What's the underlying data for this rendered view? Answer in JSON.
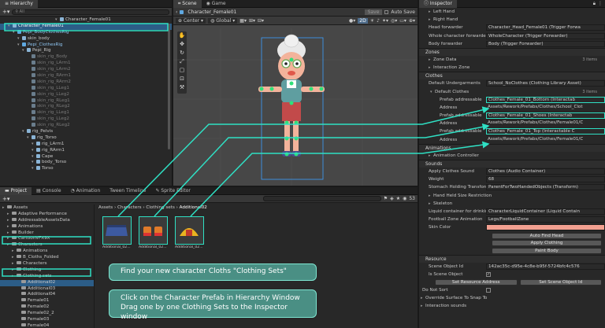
{
  "hierarchy": {
    "tab": "Hierarchy",
    "search_placeholder": "All",
    "items": [
      {
        "label": "Character_Female01",
        "indent": 0,
        "style": "root"
      },
      {
        "label": "Character_Female01",
        "indent": 1,
        "style": "selected"
      },
      {
        "label": "Pepi_BodyClothesRig",
        "indent": 2,
        "style": "blue"
      },
      {
        "label": "skin_body",
        "indent": 3,
        "style": "normal"
      },
      {
        "label": "Pepi_ClothesRig",
        "indent": 3,
        "style": "blue"
      },
      {
        "label": "Pepi_Rig",
        "indent": 4,
        "style": "normal"
      },
      {
        "label": "skin_rig_Body",
        "indent": 5,
        "style": "dim"
      },
      {
        "label": "skin_rig_LArm1",
        "indent": 5,
        "style": "dim"
      },
      {
        "label": "skin_rig_LArm2",
        "indent": 5,
        "style": "dim"
      },
      {
        "label": "skin_rig_RArm1",
        "indent": 5,
        "style": "dim"
      },
      {
        "label": "skin_rig_RArm2",
        "indent": 5,
        "style": "dim"
      },
      {
        "label": "skin_rig_LLeg1",
        "indent": 5,
        "style": "dim"
      },
      {
        "label": "skin_rig_LLeg2",
        "indent": 5,
        "style": "dim"
      },
      {
        "label": "skin_rig_RLeg1",
        "indent": 5,
        "style": "dim"
      },
      {
        "label": "skin_rig_RLeg2",
        "indent": 5,
        "style": "dim"
      },
      {
        "label": "skin_rig_LLeg1",
        "indent": 5,
        "style": "dim"
      },
      {
        "label": "skin_rig_LLeg2",
        "indent": 5,
        "style": "dim"
      },
      {
        "label": "skin_rig_RLeg2",
        "indent": 5,
        "style": "dim"
      },
      {
        "label": "rig_Pelvis",
        "indent": 4,
        "style": "normal"
      },
      {
        "label": "rig_Torso",
        "indent": 5,
        "style": "normal"
      },
      {
        "label": "rig_LArm1",
        "indent": 6,
        "style": "normal"
      },
      {
        "label": "rig_RArm1",
        "indent": 6,
        "style": "normal"
      },
      {
        "label": "Cape",
        "indent": 6,
        "style": "normal"
      },
      {
        "label": "body_Torso",
        "indent": 6,
        "style": "normal"
      },
      {
        "label": "Torso",
        "indent": 6,
        "style": "normal"
      }
    ]
  },
  "scene": {
    "tab_scene": "Scene",
    "tab_game": "Game",
    "breadcrumb": "Character_Female01",
    "save_label": "Save",
    "autosave_label": "Auto Save",
    "pivot_label": "Center",
    "space_label": "Global",
    "mode_2d": "2D"
  },
  "project": {
    "tabs": [
      "Project",
      "Console",
      "Animation",
      "Tween Timeline",
      "Sprite Editor"
    ],
    "breadcrumb": [
      "Assets",
      "Characters",
      "Clothing sets",
      "Additional02"
    ],
    "tree": [
      {
        "label": "Assets",
        "indent": 0
      },
      {
        "label": "Adaptive Performance",
        "indent": 1
      },
      {
        "label": "AddressableAssetsData",
        "indent": 1
      },
      {
        "label": "Animations",
        "indent": 1
      },
      {
        "label": "Builder",
        "indent": 1
      },
      {
        "label": "CartoonVFX9X",
        "indent": 1
      },
      {
        "label": "Characters",
        "indent": 1
      },
      {
        "label": "Animations",
        "indent": 2
      },
      {
        "label": "B_Cloths_Folded",
        "indent": 2
      },
      {
        "label": "Characters",
        "indent": 2
      },
      {
        "label": "Clothing",
        "indent": 2
      },
      {
        "label": "Clothing sets",
        "indent": 2
      },
      {
        "label": "Additional02",
        "indent": 3
      },
      {
        "label": "Additional03",
        "indent": 3
      },
      {
        "label": "Additional04",
        "indent": 3
      },
      {
        "label": "Female01",
        "indent": 3
      },
      {
        "label": "Female02",
        "indent": 3
      },
      {
        "label": "Female02_2",
        "indent": 3
      },
      {
        "label": "Female03",
        "indent": 3
      },
      {
        "label": "Female04",
        "indent": 3
      }
    ],
    "assets": [
      "Additional_02...",
      "Additional_02...",
      "Additional_02..."
    ],
    "count": "53"
  },
  "inspector": {
    "tab": "Inspector",
    "rows_top": [
      {
        "label": "Left Hand",
        "value": ""
      },
      {
        "label": "Right Hand",
        "value": ""
      },
      {
        "label": "Head forwarder",
        "value": "Character_Head_Female01 (Trigger Forwa"
      },
      {
        "label": "Whole character forwarder",
        "value": "WholeCharacter (Trigger Forwarder)"
      },
      {
        "label": "Body forwarder",
        "value": "Body (Trigger Forwarder)"
      }
    ],
    "zones_header": "Zones",
    "zone_data": "Zone Data",
    "zone_count": "3 items",
    "interaction_zone": "Interaction Zone",
    "clothes_header": "Clothes",
    "default_undergarments_label": "Default Undergarments",
    "default_undergarments_value": "School_NoClothes (Clothing Library Asset)",
    "default_clothes": "Default Clothes",
    "default_clothes_count": "3 items",
    "clothes_entries": [
      {
        "prefab_label": "Prefab addressable",
        "prefab_value": "Clothes_Female_01_Bottom (Interactab",
        "address_label": "Address",
        "address_value": "Assets/Rework/Prefabs/Clothes/School_Clot"
      },
      {
        "prefab_label": "Prefab addressable",
        "prefab_value": "Clothes_Female_01_Shoes (Interactab",
        "address_label": "Address",
        "address_value": "Assets/Rework/Prefabs/Clothes/Female01/C"
      },
      {
        "prefab_label": "Prefab addressable",
        "prefab_value": "Clothes_Female_01_Top (Interactable C",
        "address_label": "Address",
        "address_value": "Assets/Rework/Prefabs/Clothes/Female01/C"
      }
    ],
    "animations_header": "Animations",
    "animation_controller": "Animation Controller",
    "sounds_header": "Sounds",
    "apply_clothes_sound_label": "Apply Clothes Sound",
    "apply_clothes_sound_value": "Clothes (Audio Container)",
    "weight_label": "Weight",
    "weight_value": "68",
    "stomach_label": "Stomach Holding Transform",
    "stomach_value": "ParentForTwoHandedObjects (Transform)",
    "hand_held": "Hand Held Size Restriction",
    "skeleton": "Skeleton",
    "liquid_label": "Liquid container for drinking",
    "liquid_value": "CharacterLiquidContainer (Liquid Contain",
    "football_label": "Football Zone Animation",
    "football_value": "Legs/FootballZone",
    "skin_color_label": "Skin Color",
    "skin_color": "#f2a090",
    "buttons": [
      "Auto Find Head",
      "Apply Clothing",
      "Paint Body"
    ],
    "resource_header": "Resource",
    "scene_object_id_label": "Scene Object Id",
    "scene_object_id_value": "142ac35c-d95e-4c8e-b95f-5724bfc4c576",
    "is_scene_object_label": "Is Scene Object",
    "set_resource_address": "Set Resource Address",
    "set_scene_object_id": "Set Scene Object Id",
    "do_not_sort": "Do Not Sort",
    "override_surface": "Override Surface To Snap To",
    "interaction_sounds": "Interaction sounds"
  },
  "callouts": {
    "find": "Find your new character Cloths  \"Clothing Sets\"",
    "click_line1": "Click on the Character Prefab in Hierarchy Window",
    "click_line2": "Drag one by one Clothing Sets to the Inspector window"
  },
  "colors": {
    "accent": "#2fe0c4",
    "selection": "#2c5d87",
    "callout_bg": "#4a8f84"
  }
}
